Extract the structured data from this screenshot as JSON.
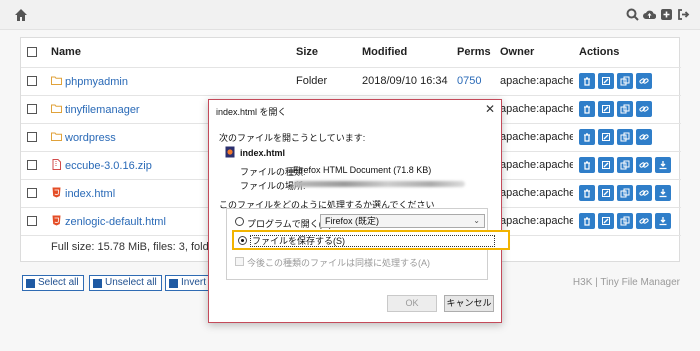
{
  "navbar": {
    "home_icon": "home-icon",
    "icons": [
      "search-icon",
      "cloud-upload-icon",
      "plus-square-icon",
      "sign-out-icon"
    ]
  },
  "table": {
    "headers": [
      "Name",
      "Size",
      "Modified",
      "Perms",
      "Owner",
      "Actions"
    ],
    "rows": [
      {
        "name": "phpmyadmin",
        "icon": "folder-icon",
        "size": "Folder",
        "modified": "2018/09/10 16:34",
        "perms": "0750",
        "owner": "apache:apache"
      },
      {
        "name": "tinyfilemanager",
        "icon": "folder-icon",
        "size": "",
        "modified": "",
        "perms": "",
        "owner": "apache:apache"
      },
      {
        "name": "wordpress",
        "icon": "folder-icon",
        "size": "",
        "modified": "",
        "perms": "",
        "owner": "apache:apache"
      },
      {
        "name": "eccube-3.0.16.zip",
        "icon": "zip-file-icon",
        "size": "",
        "modified": "",
        "perms": "",
        "owner": "apache:apache"
      },
      {
        "name": "index.html",
        "icon": "html-file-icon",
        "size": "",
        "modified": "",
        "perms": "",
        "owner": "apache:apache"
      },
      {
        "name": "zenlogic-default.html",
        "icon": "html-file-icon",
        "size": "",
        "modified": "",
        "perms": "",
        "owner": "apache:apache"
      }
    ],
    "footer": "Full size: 15.78 MiB, files: 3, folders: 3"
  },
  "buttons": {
    "select_all": "Select all",
    "unselect_all": "Unselect all",
    "invert": "Invert"
  },
  "credit": "H3K | Tiny File Manager",
  "dialog": {
    "title": "index.html を開く",
    "close": "✕",
    "lead": "次のファイルを開こうとしています:",
    "filename": "index.html",
    "type_label": "ファイルの種類:",
    "type_value": "Firefox HTML Document (71.8 KB)",
    "source_label": "ファイルの場所:",
    "question": "このファイルをどのように処理するか選んでください",
    "open_with_label": "プログラムで開く(O):",
    "open_with_value": "Firefox (既定)",
    "save_label": "ファイルを保存する(S)",
    "remember_label": "今後この種類のファイルは同様に処理する(A)",
    "ok": "OK",
    "cancel": "キャンセル"
  },
  "colors": {
    "accent": "#2f7ec9",
    "link": "#2a6ab7",
    "highlight": "#f2b400",
    "dialog_border": "#c44a5a"
  }
}
